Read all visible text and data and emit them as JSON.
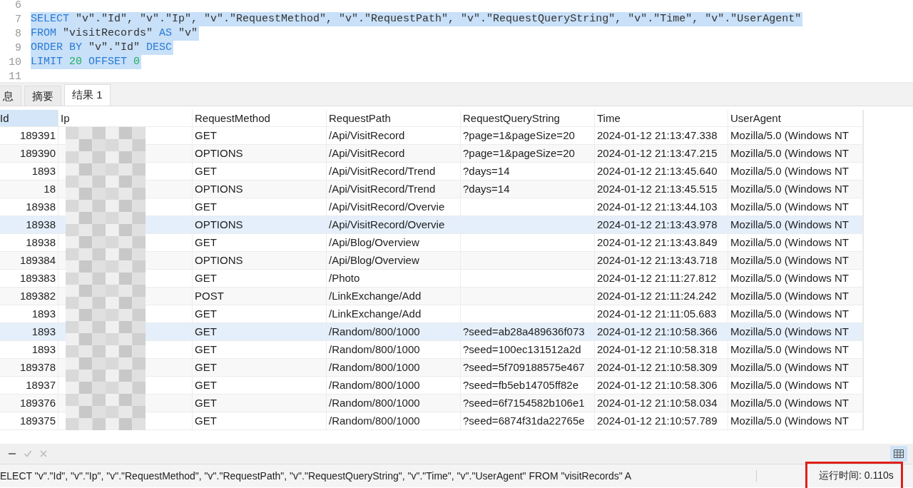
{
  "editor": {
    "lines": [
      {
        "number": "6"
      },
      {
        "number": "7",
        "selected": true,
        "tokens": [
          {
            "kind": "keyword",
            "text": "SELECT"
          },
          {
            "kind": "plain",
            "text": " \"v\".\"Id\", \"v\".\"Ip\", \"v\".\"RequestMethod\", \"v\".\"RequestPath\", \"v\".\"RequestQueryString\", \"v\".\"Time\", \"v\".\"UserAgent\""
          }
        ]
      },
      {
        "number": "8",
        "selected": true,
        "tokens": [
          {
            "kind": "keyword",
            "text": "FROM"
          },
          {
            "kind": "plain",
            "text": " \"visitRecords\" "
          },
          {
            "kind": "keyword",
            "text": "AS"
          },
          {
            "kind": "plain",
            "text": " \"v\""
          }
        ]
      },
      {
        "number": "9",
        "selected": true,
        "tokens": [
          {
            "kind": "keyword",
            "text": "ORDER BY"
          },
          {
            "kind": "plain",
            "text": " \"v\".\"Id\" "
          },
          {
            "kind": "keyword",
            "text": "DESC"
          }
        ]
      },
      {
        "number": "10",
        "selected": true,
        "tokens": [
          {
            "kind": "keyword",
            "text": "LIMIT "
          },
          {
            "kind": "number",
            "text": "20"
          },
          {
            "kind": "keyword",
            "text": " OFFSET "
          },
          {
            "kind": "number",
            "text": "0"
          }
        ]
      },
      {
        "number": "11"
      }
    ]
  },
  "tabs": [
    {
      "label": "息",
      "selected": false
    },
    {
      "label": "摘要",
      "selected": false
    },
    {
      "label": "结果 1",
      "selected": true
    }
  ],
  "table": {
    "columns": [
      {
        "label": "Id",
        "selected": true
      },
      {
        "label": "Ip",
        "selected": false
      },
      {
        "label": "RequestMethod",
        "selected": false
      },
      {
        "label": "RequestPath",
        "selected": false
      },
      {
        "label": "RequestQueryString",
        "selected": false
      },
      {
        "label": "Time",
        "selected": false
      },
      {
        "label": "UserAgent",
        "selected": false
      }
    ],
    "ip_obscured": true,
    "rows": [
      {
        "highlighted": false,
        "cells": [
          "189391",
          "",
          "GET",
          "/Api/VisitRecord",
          "?page=1&pageSize=20",
          "2024-01-12 21:13:47.338",
          "Mozilla/5.0 (Windows NT"
        ]
      },
      {
        "highlighted": false,
        "cells": [
          "189390",
          "",
          "OPTIONS",
          "/Api/VisitRecord",
          "?page=1&pageSize=20",
          "2024-01-12 21:13:47.215",
          "Mozilla/5.0 (Windows NT"
        ]
      },
      {
        "highlighted": false,
        "cells": [
          "1893",
          "",
          "GET",
          "/Api/VisitRecord/Trend",
          "?days=14",
          "2024-01-12 21:13:45.640",
          "Mozilla/5.0 (Windows NT"
        ]
      },
      {
        "highlighted": false,
        "cells": [
          "18",
          "",
          "OPTIONS",
          "/Api/VisitRecord/Trend",
          "?days=14",
          "2024-01-12 21:13:45.515",
          "Mozilla/5.0 (Windows NT"
        ]
      },
      {
        "highlighted": false,
        "cells": [
          "18938",
          "",
          "GET",
          "/Api/VisitRecord/Overvie",
          "",
          "2024-01-12 21:13:44.103",
          "Mozilla/5.0 (Windows NT"
        ]
      },
      {
        "highlighted": true,
        "cells": [
          "18938",
          "",
          "OPTIONS",
          "/Api/VisitRecord/Overvie",
          "",
          "2024-01-12 21:13:43.978",
          "Mozilla/5.0 (Windows NT"
        ]
      },
      {
        "highlighted": false,
        "cells": [
          "18938",
          "",
          "GET",
          "/Api/Blog/Overview",
          "",
          "2024-01-12 21:13:43.849",
          "Mozilla/5.0 (Windows NT"
        ]
      },
      {
        "highlighted": false,
        "cells": [
          "189384",
          "",
          "OPTIONS",
          "/Api/Blog/Overview",
          "",
          "2024-01-12 21:13:43.718",
          "Mozilla/5.0 (Windows NT"
        ]
      },
      {
        "highlighted": false,
        "cells": [
          "189383",
          "",
          "GET",
          "/Photo",
          "",
          "2024-01-12 21:11:27.812",
          "Mozilla/5.0 (Windows NT"
        ]
      },
      {
        "highlighted": false,
        "cells": [
          "189382",
          "",
          "POST",
          "/LinkExchange/Add",
          "",
          "2024-01-12 21:11:24.242",
          "Mozilla/5.0 (Windows NT"
        ]
      },
      {
        "highlighted": false,
        "cells": [
          "1893",
          "",
          "GET",
          "/LinkExchange/Add",
          "",
          "2024-01-12 21:11:05.683",
          "Mozilla/5.0 (Windows NT"
        ]
      },
      {
        "highlighted": true,
        "cells": [
          "1893",
          "",
          "GET",
          "/Random/800/1000",
          "?seed=ab28a489636f073",
          "2024-01-12 21:10:58.366",
          "Mozilla/5.0 (Windows NT"
        ]
      },
      {
        "highlighted": false,
        "cells": [
          "1893",
          "",
          "GET",
          "/Random/800/1000",
          "?seed=100ec131512a2d",
          "2024-01-12 21:10:58.318",
          "Mozilla/5.0 (Windows NT"
        ]
      },
      {
        "highlighted": false,
        "cells": [
          "189378",
          "",
          "GET",
          "/Random/800/1000",
          "?seed=5f709188575e467",
          "2024-01-12 21:10:58.309",
          "Mozilla/5.0 (Windows NT"
        ]
      },
      {
        "highlighted": false,
        "cells": [
          "18937",
          "",
          "GET",
          "/Random/800/1000",
          "?seed=fb5eb14705ff82e",
          "2024-01-12 21:10:58.306",
          "Mozilla/5.0 (Windows NT"
        ]
      },
      {
        "highlighted": false,
        "cells": [
          "189376",
          "",
          "GET",
          "/Random/800/1000",
          "?seed=6f7154582b106e1",
          "2024-01-12 21:10:58.034",
          "Mozilla/5.0 (Windows NT"
        ]
      },
      {
        "highlighted": false,
        "cells": [
          "189375",
          "",
          "GET",
          "/Random/800/1000",
          "?seed=6874f31da22765e",
          "2024-01-12 21:10:57.789",
          "Mozilla/5.0 (Windows NT"
        ]
      }
    ]
  },
  "toolbar": {
    "grid_view_selected": true
  },
  "status_bar": {
    "query": "ELECT \"v\".\"Id\", \"v\".\"Ip\", \"v\".\"RequestMethod\", \"v\".\"RequestPath\", \"v\".\"RequestQueryString\", \"v\".\"Time\", \"v\".\"UserAgent\" FROM \"visitRecords\" A",
    "runtime": "运行时间: 0.110s",
    "runtime_highlighted": true
  }
}
